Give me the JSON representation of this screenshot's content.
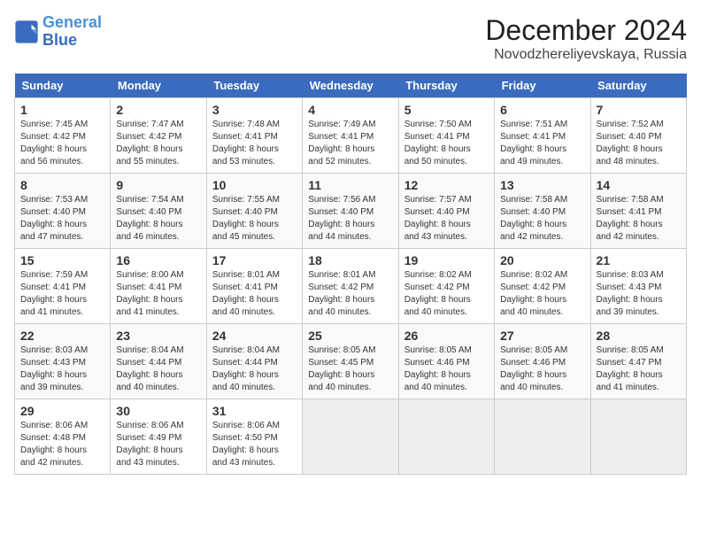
{
  "logo": {
    "line1": "General",
    "line2": "Blue"
  },
  "title": "December 2024",
  "subtitle": "Novodzhereliyevskaya, Russia",
  "days_header": [
    "Sunday",
    "Monday",
    "Tuesday",
    "Wednesday",
    "Thursday",
    "Friday",
    "Saturday"
  ],
  "weeks": [
    [
      {
        "num": "1",
        "sunrise": "7:45 AM",
        "sunset": "4:42 PM",
        "daylight": "8 hours and 56 minutes."
      },
      {
        "num": "2",
        "sunrise": "7:47 AM",
        "sunset": "4:42 PM",
        "daylight": "8 hours and 55 minutes."
      },
      {
        "num": "3",
        "sunrise": "7:48 AM",
        "sunset": "4:41 PM",
        "daylight": "8 hours and 53 minutes."
      },
      {
        "num": "4",
        "sunrise": "7:49 AM",
        "sunset": "4:41 PM",
        "daylight": "8 hours and 52 minutes."
      },
      {
        "num": "5",
        "sunrise": "7:50 AM",
        "sunset": "4:41 PM",
        "daylight": "8 hours and 50 minutes."
      },
      {
        "num": "6",
        "sunrise": "7:51 AM",
        "sunset": "4:41 PM",
        "daylight": "8 hours and 49 minutes."
      },
      {
        "num": "7",
        "sunrise": "7:52 AM",
        "sunset": "4:40 PM",
        "daylight": "8 hours and 48 minutes."
      }
    ],
    [
      {
        "num": "8",
        "sunrise": "7:53 AM",
        "sunset": "4:40 PM",
        "daylight": "8 hours and 47 minutes."
      },
      {
        "num": "9",
        "sunrise": "7:54 AM",
        "sunset": "4:40 PM",
        "daylight": "8 hours and 46 minutes."
      },
      {
        "num": "10",
        "sunrise": "7:55 AM",
        "sunset": "4:40 PM",
        "daylight": "8 hours and 45 minutes."
      },
      {
        "num": "11",
        "sunrise": "7:56 AM",
        "sunset": "4:40 PM",
        "daylight": "8 hours and 44 minutes."
      },
      {
        "num": "12",
        "sunrise": "7:57 AM",
        "sunset": "4:40 PM",
        "daylight": "8 hours and 43 minutes."
      },
      {
        "num": "13",
        "sunrise": "7:58 AM",
        "sunset": "4:40 PM",
        "daylight": "8 hours and 42 minutes."
      },
      {
        "num": "14",
        "sunrise": "7:58 AM",
        "sunset": "4:41 PM",
        "daylight": "8 hours and 42 minutes."
      }
    ],
    [
      {
        "num": "15",
        "sunrise": "7:59 AM",
        "sunset": "4:41 PM",
        "daylight": "8 hours and 41 minutes."
      },
      {
        "num": "16",
        "sunrise": "8:00 AM",
        "sunset": "4:41 PM",
        "daylight": "8 hours and 41 minutes."
      },
      {
        "num": "17",
        "sunrise": "8:01 AM",
        "sunset": "4:41 PM",
        "daylight": "8 hours and 40 minutes."
      },
      {
        "num": "18",
        "sunrise": "8:01 AM",
        "sunset": "4:42 PM",
        "daylight": "8 hours and 40 minutes."
      },
      {
        "num": "19",
        "sunrise": "8:02 AM",
        "sunset": "4:42 PM",
        "daylight": "8 hours and 40 minutes."
      },
      {
        "num": "20",
        "sunrise": "8:02 AM",
        "sunset": "4:42 PM",
        "daylight": "8 hours and 40 minutes."
      },
      {
        "num": "21",
        "sunrise": "8:03 AM",
        "sunset": "4:43 PM",
        "daylight": "8 hours and 39 minutes."
      }
    ],
    [
      {
        "num": "22",
        "sunrise": "8:03 AM",
        "sunset": "4:43 PM",
        "daylight": "8 hours and 39 minutes."
      },
      {
        "num": "23",
        "sunrise": "8:04 AM",
        "sunset": "4:44 PM",
        "daylight": "8 hours and 40 minutes."
      },
      {
        "num": "24",
        "sunrise": "8:04 AM",
        "sunset": "4:44 PM",
        "daylight": "8 hours and 40 minutes."
      },
      {
        "num": "25",
        "sunrise": "8:05 AM",
        "sunset": "4:45 PM",
        "daylight": "8 hours and 40 minutes."
      },
      {
        "num": "26",
        "sunrise": "8:05 AM",
        "sunset": "4:46 PM",
        "daylight": "8 hours and 40 minutes."
      },
      {
        "num": "27",
        "sunrise": "8:05 AM",
        "sunset": "4:46 PM",
        "daylight": "8 hours and 40 minutes."
      },
      {
        "num": "28",
        "sunrise": "8:05 AM",
        "sunset": "4:47 PM",
        "daylight": "8 hours and 41 minutes."
      }
    ],
    [
      {
        "num": "29",
        "sunrise": "8:06 AM",
        "sunset": "4:48 PM",
        "daylight": "8 hours and 42 minutes."
      },
      {
        "num": "30",
        "sunrise": "8:06 AM",
        "sunset": "4:49 PM",
        "daylight": "8 hours and 43 minutes."
      },
      {
        "num": "31",
        "sunrise": "8:06 AM",
        "sunset": "4:50 PM",
        "daylight": "8 hours and 43 minutes."
      },
      null,
      null,
      null,
      null
    ]
  ]
}
